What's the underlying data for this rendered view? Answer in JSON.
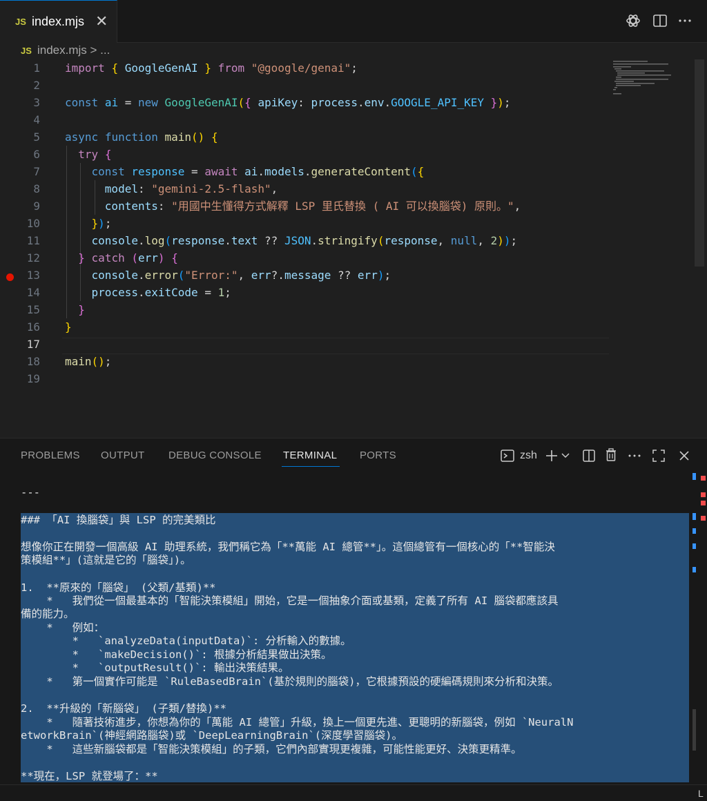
{
  "tab": {
    "badge": "JS",
    "title": "index.mjs",
    "close": "✕"
  },
  "breadcrumb": {
    "badge": "JS",
    "text": "index.mjs > ..."
  },
  "editor": {
    "line_numbers": [
      "1",
      "2",
      "3",
      "4",
      "5",
      "6",
      "7",
      "8",
      "9",
      "10",
      "11",
      "12",
      "13",
      "14",
      "15",
      "16",
      "17",
      "18",
      "19"
    ],
    "active_line": "17",
    "breakpoint_line": "13"
  },
  "panel": {
    "tabs": [
      "PROBLEMS",
      "OUTPUT",
      "DEBUG CONSOLE",
      "TERMINAL",
      "PORTS"
    ],
    "active_tab": "TERMINAL",
    "shell": "zsh"
  },
  "terminal": {
    "lines": [
      "---",
      "",
      "### 「AI 換腦袋」與 LSP 的完美類比",
      "",
      "想像你正在開發一個高級 AI 助理系統，我們稱它為「**萬能 AI 總管**」。這個總管有一個核心的「**智能決",
      "策模組**」(這就是它的「腦袋」)。",
      "",
      "1.  **原來的「腦袋」 (父類/基類)**",
      "    *   我們從一個最基本的「智能決策模組」開始，它是一個抽象介面或基類，定義了所有 AI 腦袋都應該具",
      "備的能力。",
      "    *   例如：",
      "        *   `analyzeData(inputData)`: 分析輸入的數據。",
      "        *   `makeDecision()`: 根據分析結果做出決策。",
      "        *   `outputResult()`: 輸出決策結果。",
      "    *   第一個實作可能是 `RuleBasedBrain`(基於規則的腦袋)，它根據預設的硬編碼規則來分析和決策。",
      "",
      "2.  **升級的「新腦袋」 (子類/替換)**",
      "    *   隨著技術進步，你想為你的「萬能 AI 總管」升級，換上一個更先進、更聰明的新腦袋，例如 `NeuralN",
      "etworkBrain`(神經網路腦袋)或 `DeepLearningBrain`(深度學習腦袋)。",
      "    *   這些新腦袋都是「智能決策模組」的子類，它們內部實現更複雜，可能性能更好、決策更精準。",
      "",
      "**現在，LSP 就登場了：**"
    ]
  },
  "status": {
    "right_letter": "L"
  }
}
